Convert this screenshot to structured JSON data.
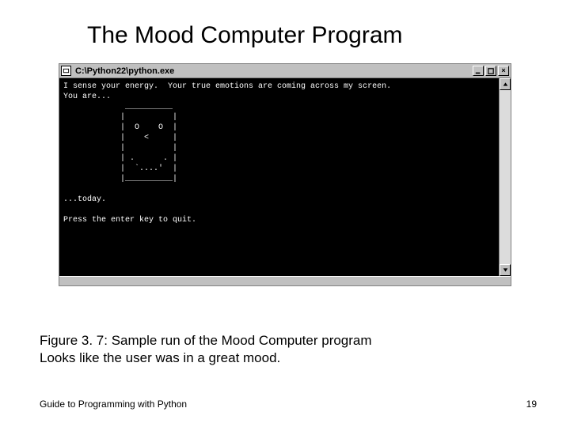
{
  "slide": {
    "title": "The Mood Computer Program",
    "caption_line1": "Figure 3. 7: Sample run of the Mood Computer program",
    "caption_line2": "Looks like the user was in a great mood.",
    "footer_left": "Guide to Programming with Python",
    "footer_right": "19"
  },
  "console": {
    "window_title": "C:\\Python22\\python.exe",
    "lines": [
      "I sense your energy.  Your true emotions are coming across my screen.",
      "You are...",
      "             __________",
      "            |          |",
      "            |  O    O  |",
      "            |    <     |",
      "            |          |",
      "            | .      . |",
      "            |  `....'  |",
      "            |__________|",
      "",
      "...today.",
      "",
      "Press the enter key to quit."
    ]
  }
}
